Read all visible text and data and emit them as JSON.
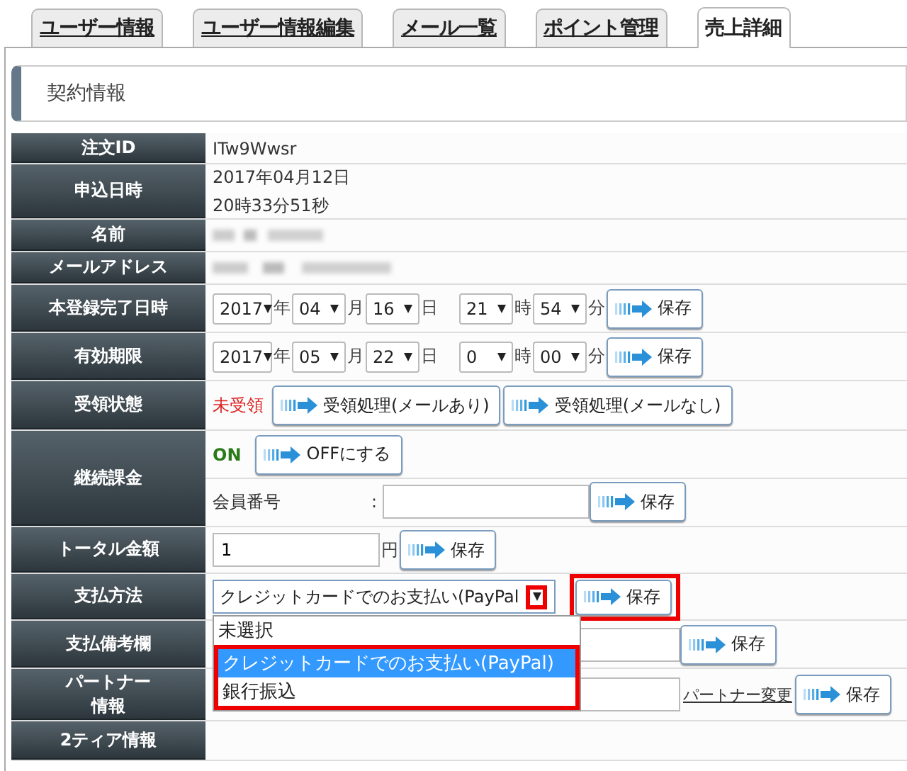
{
  "tabs": [
    {
      "label": "ユーザー情報",
      "selected": false
    },
    {
      "label": "ユーザー情報編集",
      "selected": false
    },
    {
      "label": "メール一覧",
      "selected": false
    },
    {
      "label": "ポイント管理",
      "selected": false
    },
    {
      "label": "売上詳細",
      "selected": true
    }
  ],
  "section_title": "契約情報",
  "rows": [
    {
      "kind": "text",
      "label": "注文ID",
      "lines": [
        "ITw9Wwsr"
      ]
    },
    {
      "kind": "text",
      "label": "申込日時",
      "lines": [
        "2017年04月12日",
        "20時33分51秒"
      ]
    },
    {
      "kind": "redacted",
      "label": "名前"
    },
    {
      "kind": "redacted",
      "label": "メールアドレス"
    },
    {
      "kind": "datetime",
      "label": "本登録完了日時",
      "selects": [
        {
          "value": "2017",
          "unit": "年"
        },
        {
          "value": "04",
          "unit": "月"
        },
        {
          "value": "16",
          "unit": "日"
        },
        {
          "value": "21",
          "unit": "時"
        },
        {
          "value": "54",
          "unit": "分"
        }
      ],
      "button": "保存"
    },
    {
      "kind": "datetime",
      "label": "有効期限",
      "selects": [
        {
          "value": "2017",
          "unit": "年"
        },
        {
          "value": "05",
          "unit": "月"
        },
        {
          "value": "22",
          "unit": "日"
        },
        {
          "value": "0",
          "unit": "時"
        },
        {
          "value": "00",
          "unit": "分"
        }
      ],
      "button": "保存"
    },
    {
      "kind": "status",
      "label": "受領状態",
      "status": "未受領",
      "buttons": [
        "受領処理(メールあり)",
        "受領処理(メールなし)"
      ]
    },
    {
      "kind": "billing",
      "label": "継続課金",
      "state": "ON",
      "button": "OFFにする",
      "field_label": "会員番号",
      "separator": ":",
      "field_button": "保存"
    },
    {
      "kind": "amount",
      "label": "トータル金額",
      "value": "1",
      "unit": "円",
      "button": "保存"
    },
    {
      "kind": "select",
      "label": "支払方法",
      "value": "クレジットカードでのお支払い(PayPal",
      "arrow_highlighted": true,
      "button": "保存",
      "button_highlighted": true,
      "expanded": true,
      "options": [
        {
          "label": "未選択",
          "selected": false,
          "highlighted": false
        },
        {
          "label": "クレジットカードでのお支払い(PayPal)",
          "selected": true,
          "highlighted": true
        },
        {
          "label": "銀行振込",
          "selected": false,
          "highlighted": true
        }
      ]
    },
    {
      "kind": "input",
      "label": "支払備考欄",
      "button": "保存"
    },
    {
      "kind": "input",
      "label_lines": [
        "パートナー",
        "情報"
      ],
      "link": "パートナー変更",
      "button": "保存"
    },
    {
      "kind": "text",
      "label": "2ティア情報",
      "lines": []
    }
  ]
}
